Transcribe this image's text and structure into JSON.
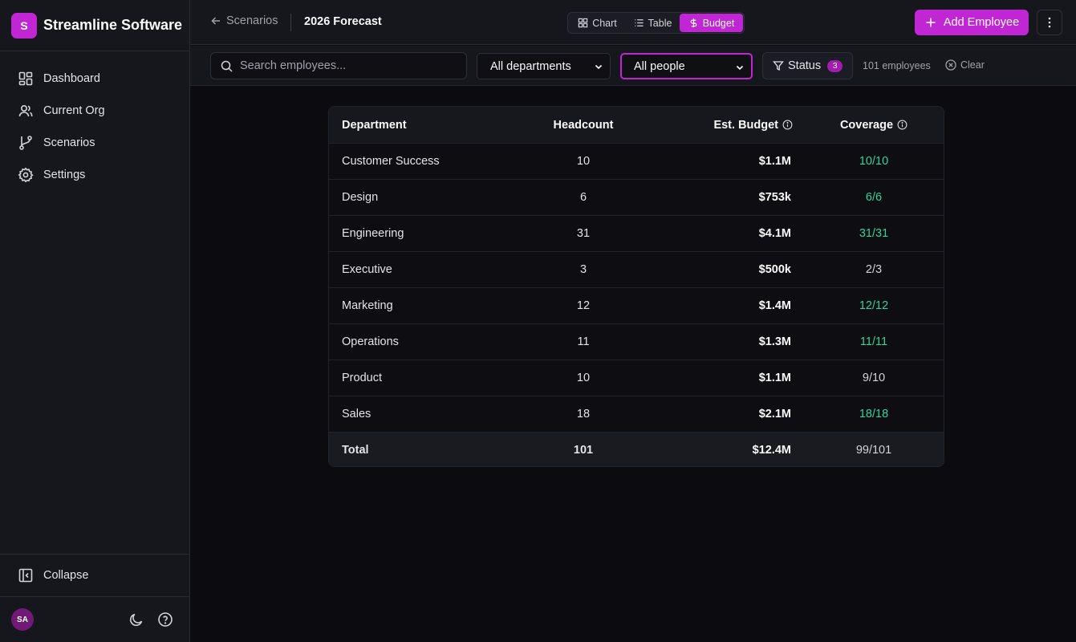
{
  "brand": {
    "initial": "S",
    "name": "Streamline Software"
  },
  "nav": [
    {
      "label": "Dashboard",
      "icon": "dashboard-icon"
    },
    {
      "label": "Current Org",
      "icon": "users-icon"
    },
    {
      "label": "Scenarios",
      "icon": "git-branch-icon"
    },
    {
      "label": "Settings",
      "icon": "gear-icon"
    }
  ],
  "sidebar_footer": {
    "collapse_label": "Collapse",
    "avatar_initials": "SA"
  },
  "topbar": {
    "back_label": "Scenarios",
    "title": "2026 Forecast",
    "views": {
      "chart": "Chart",
      "table": "Table",
      "budget": "Budget",
      "active": "Budget"
    },
    "add_button": "Add Employee"
  },
  "filters": {
    "search_placeholder": "Search employees...",
    "department_value": "All departments",
    "people_value": "All people",
    "status_label": "Status",
    "status_count": "3",
    "employee_count": "101 employees",
    "clear_label": "Clear"
  },
  "table": {
    "columns": [
      "Department",
      "Headcount",
      "Est. Budget",
      "Coverage"
    ],
    "rows": [
      {
        "department": "Customer Success",
        "headcount": "10",
        "budget": "$1.1M",
        "coverage": "10/10",
        "full": true
      },
      {
        "department": "Design",
        "headcount": "6",
        "budget": "$753k",
        "coverage": "6/6",
        "full": true
      },
      {
        "department": "Engineering",
        "headcount": "31",
        "budget": "$4.1M",
        "coverage": "31/31",
        "full": true
      },
      {
        "department": "Executive",
        "headcount": "3",
        "budget": "$500k",
        "coverage": "2/3",
        "full": false
      },
      {
        "department": "Marketing",
        "headcount": "12",
        "budget": "$1.4M",
        "coverage": "12/12",
        "full": true
      },
      {
        "department": "Operations",
        "headcount": "11",
        "budget": "$1.3M",
        "coverage": "11/11",
        "full": true
      },
      {
        "department": "Product",
        "headcount": "10",
        "budget": "$1.1M",
        "coverage": "9/10",
        "full": false
      },
      {
        "department": "Sales",
        "headcount": "18",
        "budget": "$2.1M",
        "coverage": "18/18",
        "full": true
      }
    ],
    "total": {
      "label": "Total",
      "headcount": "101",
      "budget": "$12.4M",
      "coverage": "99/101"
    }
  },
  "colors": {
    "accent": "#c026d3",
    "coverage_full": "#34d399",
    "background": "#0b0b10",
    "sidebar": "#16161d"
  }
}
